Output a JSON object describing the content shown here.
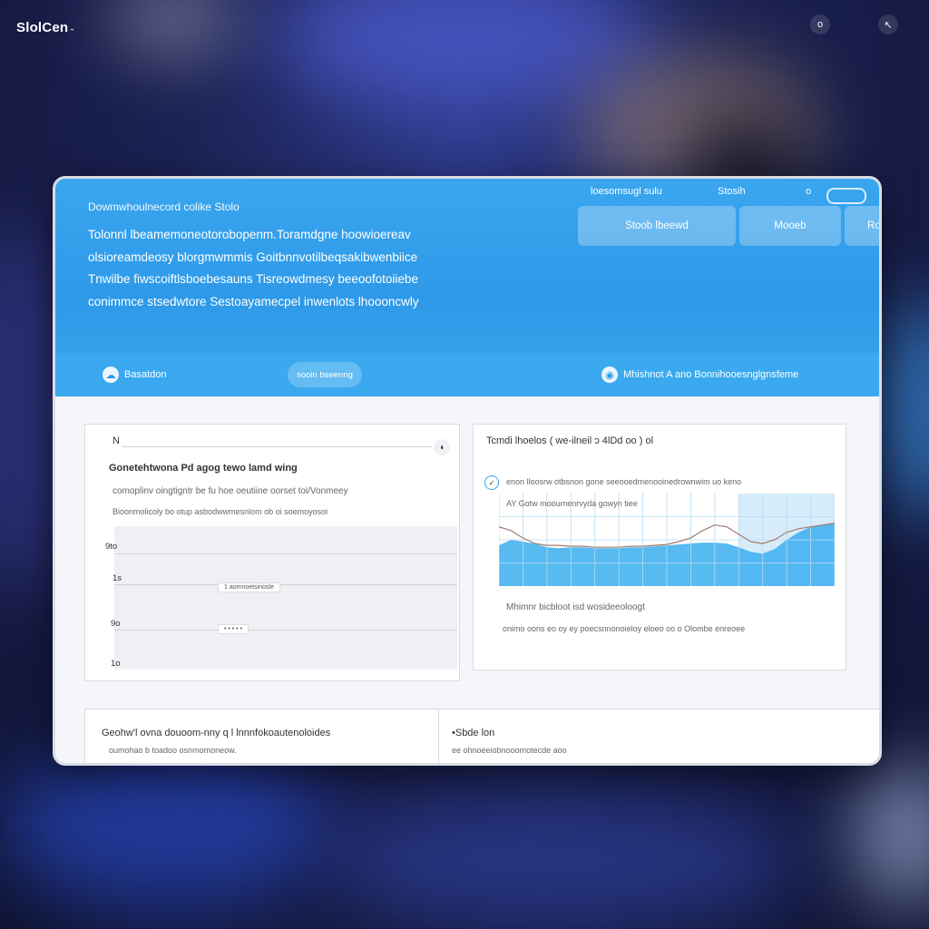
{
  "brand": {
    "name": "SlolCen",
    "suffix": "⌁"
  },
  "topbar": {
    "icon_a": "o",
    "icon_b": "↖"
  },
  "window": {
    "breadcrumb": "Dowmwhoulnecord colike Stolo",
    "hero_lines": [
      "Tolonnl lbeamemoneotorobopenm.Toramdgne hoowioereav",
      "olsioreamdeosy blorgmwmmis Goitbnnvotilbeqsakibwenbiice",
      "Tnwilbe fiwscoiftlsboebesauns Tisreowdmesy beeoofotoiiebe",
      "conimmce stsedwtore    Sestoayamecpel inwenlots lhoooncwly"
    ],
    "top_nav": {
      "item1": "loesomsugl sulu",
      "item2": "Stosih",
      "item3": "o"
    },
    "pills": [
      "Stoob lbeewd",
      "Mooeb",
      "Roleeunboe"
    ],
    "toolbar": {
      "left_label": "Basatdon",
      "left_icon": "cloud-icon",
      "chip": "sooin bseenng",
      "right_label": "Mhishnot A ano Bonnihooesnglgnsfeme",
      "right_icon": "shield-icon"
    },
    "left_card": {
      "corner": "N",
      "corner_button": "◖",
      "title": "Gonetehtwona Pd agog tewo lamd wing",
      "desc1": "comoplinv oingtigntr be fu hoe oeutiine oorset toi/Vonmeey",
      "desc2": "Bioonmolicoly bo otup asbodwwmesnlom ob oi soemoyosoi",
      "y_ticks": [
        "9to",
        "1s",
        "9o",
        "1o"
      ],
      "chip1": "1 aomnoetsinosle",
      "chip2": "• • •  • •"
    },
    "right_card": {
      "title": "Tcmdi lhoelos  ( we-ilneil  ↄ     4lDd oo  )  ol",
      "legend1": "enon lloosrw otbsnon gone seeooedmenooinedrownwim uo keno",
      "legend2": "AY Gotw mooumenrvyda  gowyn tiee",
      "caption1": "Mhimnr bicbloot isd wosideeoloogt",
      "caption2": "onimo oons eo oy ey poecsnnonoieloy eloeo oo o Olombe enreoee"
    },
    "bottom_left": {
      "title": "Geohw'l ovna douoom-nny q l lnnnfokoautenoloides",
      "sub": "oumohao b toadoo osnmomoneow."
    },
    "bottom_right": {
      "title": "•Sbde lon",
      "sub": "ee ohnoeeiobnooomotecde aoo"
    }
  },
  "chart_data": {
    "type": "area",
    "title": "Tcmdi lhoelos",
    "series": [
      {
        "values": [
          44,
          50,
          48,
          46,
          42,
          41,
          42,
          42,
          41,
          41,
          41,
          42,
          42,
          43,
          44,
          45,
          46,
          47,
          47,
          46,
          42,
          37,
          35,
          40,
          50,
          58,
          64,
          66,
          68
        ]
      },
      {
        "values": [
          64,
          60,
          52,
          46,
          44,
          44,
          43,
          43,
          42,
          42,
          42,
          43,
          43,
          44,
          45,
          48,
          52,
          60,
          66,
          64,
          56,
          48,
          46,
          50,
          58,
          62,
          64,
          66,
          68
        ]
      }
    ],
    "colors": {
      "area": "#45b2f0",
      "line": "#a57b6d",
      "grid": "#b9dcf4",
      "highlight": "#d6ecfb"
    },
    "highlight_from_index": 20
  }
}
